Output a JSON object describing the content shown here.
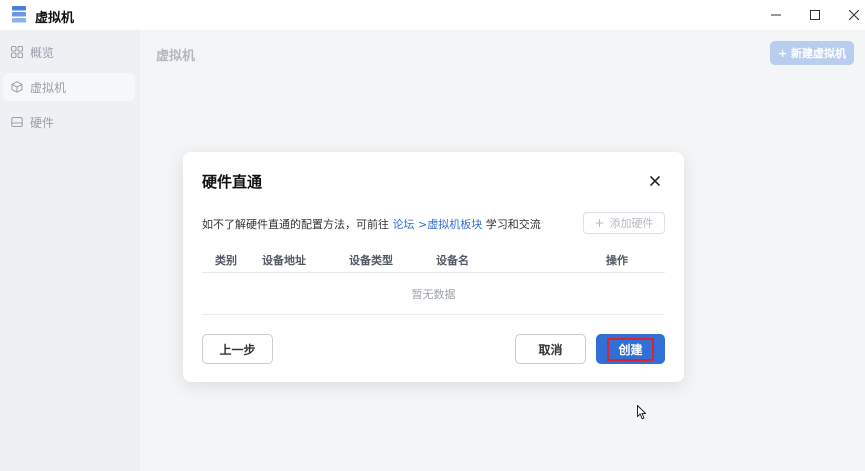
{
  "window": {
    "title": "虚拟机",
    "minimize": "—",
    "maximize": "☐",
    "close": "✕"
  },
  "sidebar": {
    "items": [
      {
        "label": "概览",
        "icon": "grid-icon"
      },
      {
        "label": "虚拟机",
        "icon": "cube-icon",
        "active": true
      },
      {
        "label": "硬件",
        "icon": "drive-icon"
      }
    ]
  },
  "main": {
    "title": "虚拟机",
    "new_button": "+ 新建虚拟机"
  },
  "dialog": {
    "title": "硬件直通",
    "hint_prefix": "如不了解硬件直通的配置方法，可前往 ",
    "hint_link": "论坛 >虚拟机板块",
    "hint_suffix": " 学习和交流",
    "add_button": "添加硬件",
    "add_button_icon": "+",
    "columns": [
      "类别",
      "设备地址",
      "设备类型",
      "设备名",
      "操作"
    ],
    "empty_text": "暂无数据",
    "prev_button": "上一步",
    "cancel_button": "取消",
    "create_button": "创建"
  },
  "colors": {
    "accent": "#2f6fd6",
    "highlight": "#e0202c"
  }
}
